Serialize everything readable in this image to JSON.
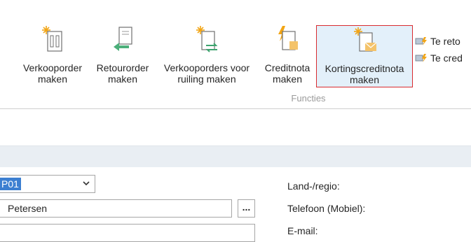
{
  "ribbon": {
    "buttons": [
      {
        "label1": "Verkooporder",
        "label2": "maken"
      },
      {
        "label1": "Retourorder",
        "label2": "maken"
      },
      {
        "label1": "Verkooporders voor",
        "label2": "ruiling maken"
      },
      {
        "label1": "Creditnota",
        "label2": "maken"
      },
      {
        "label1": "Kortingscreditnota",
        "label2": "maken"
      }
    ],
    "group_label": "Functies",
    "small_buttons": [
      "Te reto",
      "Te cred"
    ]
  },
  "form": {
    "select_value": "P01",
    "name_value": "Petersen",
    "lookup_button": "...",
    "labels": {
      "country": "Land-/regio:",
      "phone": "Telefoon (Mobiel):",
      "email": "E-mail:"
    }
  },
  "colors": {
    "selection_border": "#d92b2f",
    "selection_fill": "#e3f0fa",
    "band": "#e9eef3",
    "select_highlight": "#3c7fd1"
  }
}
